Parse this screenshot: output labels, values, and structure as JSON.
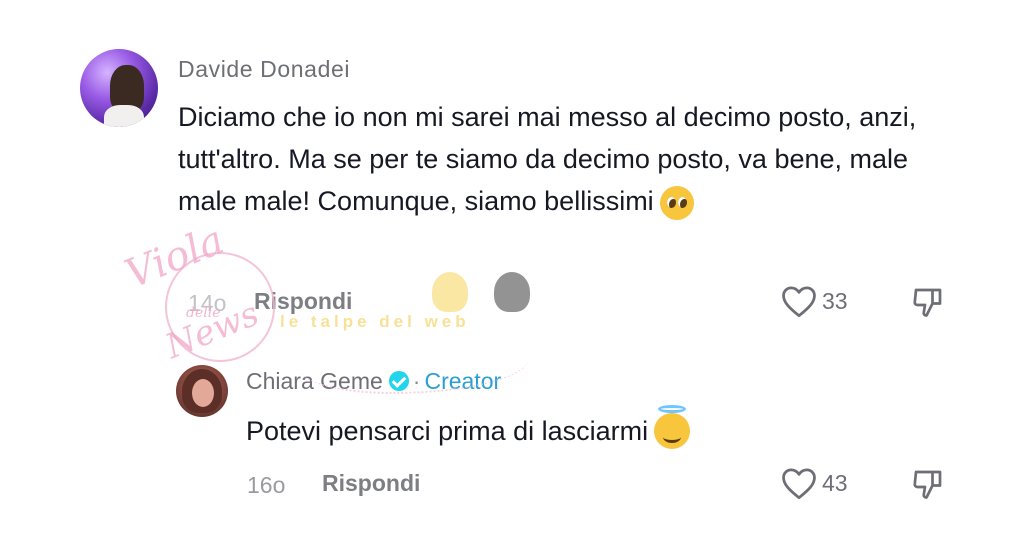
{
  "comments": [
    {
      "username": "Davide Donadei",
      "text": "Diciamo che io non mi sarei mai messo al decimo posto, anzi, tutt'altro. Ma se per te siamo da decimo posto, va bene, male male male! Comunque, siamo bellissimi",
      "emoji": "pleading-face",
      "time": "14o",
      "reply_label": "Rispondi",
      "likes": "33"
    },
    {
      "username": "Chiara Geme",
      "badge": "Creator",
      "separator": "·",
      "verified": true,
      "text": "Potevi pensarci prima di lasciarmi",
      "emoji": "smiling-face-with-halo",
      "time": "16o",
      "reply_label": "Rispondi",
      "likes": "43"
    }
  ],
  "watermark": {
    "script": "Viola",
    "sub": "delle",
    "tail": "News",
    "band": "le talpe del web"
  },
  "colors": {
    "text": "#161823",
    "muted": "#8a8b91",
    "creator": "#2b9fd4",
    "verified": "#20d5ec"
  }
}
